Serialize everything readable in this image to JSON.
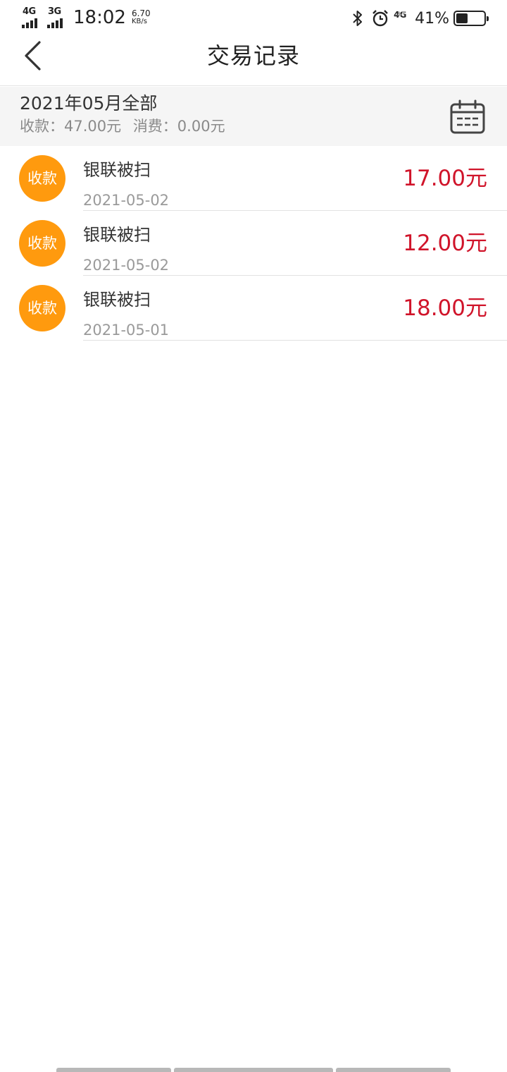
{
  "status_bar": {
    "sim1_network": "4G",
    "sim2_network": "3G",
    "time": "18:02",
    "speed_value": "6.70",
    "speed_unit": "KB/s",
    "right_network": "4G",
    "battery_percent": "41%",
    "battery_level": 0.41,
    "icons": [
      "bluetooth-icon",
      "alarm-icon",
      "battery-icon"
    ]
  },
  "header": {
    "title": "交易记录",
    "back_icon": "chevron-left-icon"
  },
  "summary": {
    "title": "2021年05月全部",
    "income_text": "收款：47.00元",
    "expense_text": "消费：0.00元",
    "calendar_icon": "calendar-icon"
  },
  "records": [
    {
      "badge": "收款",
      "name": "银联被扫",
      "date": "2021-05-02",
      "amount": "17.00元"
    },
    {
      "badge": "收款",
      "name": "银联被扫",
      "date": "2021-05-02",
      "amount": "12.00元"
    },
    {
      "badge": "收款",
      "name": "银联被扫",
      "date": "2021-05-01",
      "amount": "18.00元"
    }
  ],
  "colors": {
    "badge_bg": "#ff9a0e",
    "amount": "#d0142a",
    "summary_bg": "#f5f5f5"
  }
}
